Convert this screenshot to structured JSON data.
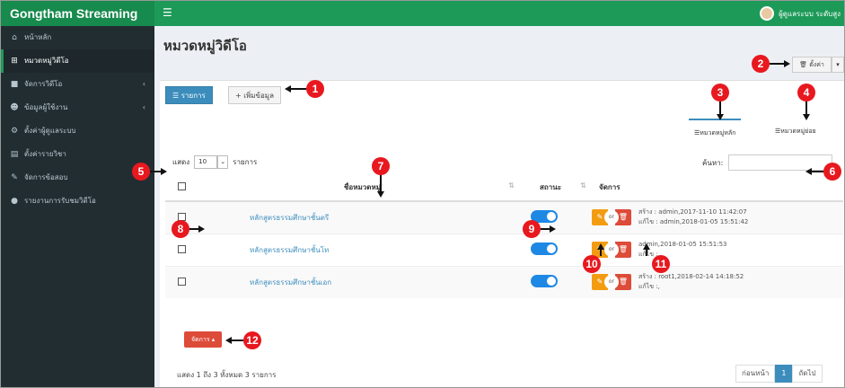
{
  "app": {
    "brand": "Gongtham Streaming",
    "user_name": "ผู้ดูแลระบบ ระดับสูง"
  },
  "sidebar": {
    "items": [
      {
        "label": "หน้าหลัก",
        "icon": "home-icon"
      },
      {
        "label": "หมวดหมู่วิดีโอ",
        "icon": "sitemap-icon",
        "active": true
      },
      {
        "label": "จัดการวิดีโอ",
        "icon": "video-icon",
        "chevron": "‹"
      },
      {
        "label": "ข้อมูลผู้ใช้งาน",
        "icon": "users-icon",
        "chevron": "‹"
      },
      {
        "label": "ตั้งค่าผู้ดูแลระบบ",
        "icon": "gears-icon"
      },
      {
        "label": "ตั้งค่ารายวิชา",
        "icon": "book-icon"
      },
      {
        "label": "จัดการข้อสอบ",
        "icon": "edit-icon"
      },
      {
        "label": "รายงานการรับชมวิดีโอ",
        "icon": "globe-icon"
      }
    ]
  },
  "page": {
    "title": "หมวดหมู่วิดีโอ",
    "setting_label": "ตั้งค่า"
  },
  "toolbar": {
    "list_label": "รายการ",
    "add_label": "+ เพิ่มข้อมูล"
  },
  "tabs": {
    "main": "หมวดหมู่หลัก",
    "sub": "หมวดหมู่ย่อย"
  },
  "length": {
    "prefix": "แสดง",
    "value": "10",
    "suffix": "รายการ"
  },
  "search": {
    "label": "ค้นหา:",
    "placeholder": ""
  },
  "table": {
    "headers": {
      "name": "ชื่อหมวดหมู่",
      "status": "สถานะ",
      "manage": "จัดการ"
    },
    "rows": [
      {
        "name": "หลักสูตรธรรมศึกษาชั้นตรี",
        "created": "สร้าง : admin,2017-11-10 11:42:07",
        "updated": "แก้ไข : admin,2018-01-05 15:51:42"
      },
      {
        "name": "หลักสูตรธรรมศึกษาชั้นโท",
        "created": "admin,2018-01-05 15:51:53",
        "updated": "แก้ไข :,"
      },
      {
        "name": "หลักสูตรธรรมศึกษาชั้นเอก",
        "created": "สร้าง : root1,2018-02-14 14:18:52",
        "updated": "แก้ไข :,"
      }
    ],
    "or_label": "or"
  },
  "bulk": {
    "label": "จัดการ ▴"
  },
  "footer": {
    "summary": "แสดง 1 ถึง 3 ทั้งหมด 3 รายการ",
    "prev": "ก่อนหน้า",
    "page": "1",
    "next": "ถัดไป"
  },
  "callouts": [
    "1",
    "2",
    "3",
    "4",
    "5",
    "6",
    "7",
    "8",
    "9",
    "10",
    "11",
    "12"
  ],
  "colors": {
    "topbar": "#1d9a58",
    "sidebar": "#222d32",
    "primary": "#3c8dbc",
    "callout": "#e8181f",
    "toggle": "#1e88e5"
  }
}
